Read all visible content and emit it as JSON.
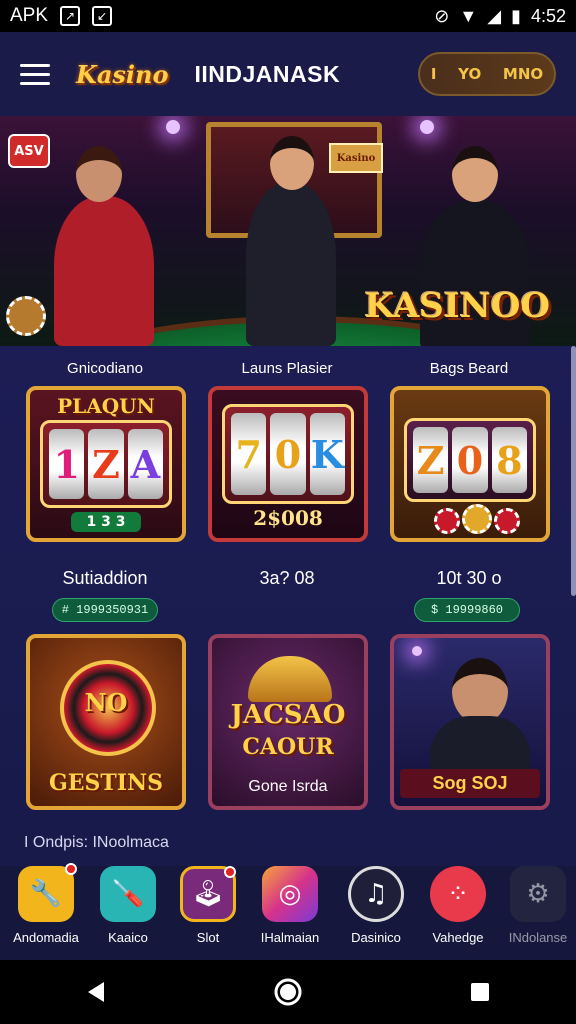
{
  "status_bar": {
    "carrier": "APK",
    "time": "4:52"
  },
  "header": {
    "logo": "Kasino",
    "title": "IINDJANASK",
    "pill_left": "I",
    "pill_mid": "YO",
    "pill_right": "MNO"
  },
  "hero": {
    "badge": "ASV",
    "logo": "KASINOO",
    "board_text": "Kasino"
  },
  "games_row1": [
    {
      "label": "Gnicodiano",
      "tile_title": "PLAQUN",
      "reels": [
        "1",
        "Z",
        "A"
      ],
      "footer": "1 3 3",
      "caption": "Sutiaddion",
      "pill": "# 1999350931"
    },
    {
      "label": "Launs Plasier",
      "tile_title": "",
      "reels": [
        "7",
        "0",
        "K"
      ],
      "footer": "2$008",
      "caption": "3a? 08",
      "pill": ""
    },
    {
      "label": "Bags Beard",
      "tile_title": "",
      "reels": [
        "Z",
        "0",
        "8"
      ],
      "footer": "",
      "caption": "10t 30 o",
      "pill": "$ 19999860"
    }
  ],
  "games_row2": [
    {
      "main": "NO",
      "footer": "GESTINS"
    },
    {
      "main": "JACSAO",
      "sub": "CAOUR",
      "footer": "Gone Isrda"
    },
    {
      "footer": "Sog SOJ"
    }
  ],
  "section_label": "I Ondpis: INoolmaca",
  "dock": [
    {
      "label": "Andomadia",
      "icon": "wrench-icon",
      "color": "#f2b61c",
      "dot": true
    },
    {
      "label": "Kaaico",
      "icon": "tool-icon",
      "color": "#2ab5b5",
      "dot": false
    },
    {
      "label": "Slot",
      "icon": "joystick-icon",
      "color": "#7a2a7a",
      "dot": true
    },
    {
      "label": "IHalmaian",
      "icon": "camera-icon",
      "color": "#d6338a",
      "dot": false
    },
    {
      "label": "Dasinico",
      "icon": "music-note-icon",
      "color": "#1f1f3a",
      "dot": false
    },
    {
      "label": "Vahedge",
      "icon": "dots-icon",
      "color": "#e83a4a",
      "dot": false
    },
    {
      "label": "INdolanse",
      "icon": "gear-icon",
      "color": "#2c2f45",
      "dot": false
    }
  ]
}
